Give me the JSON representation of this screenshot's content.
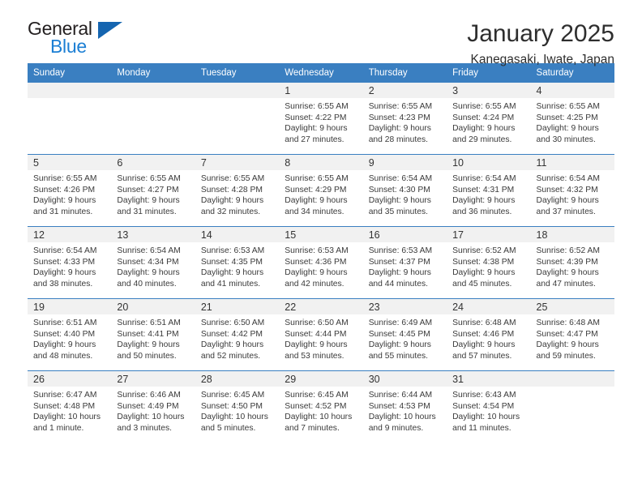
{
  "logo": {
    "text_top": "General",
    "text_bottom": "Blue",
    "triangle_color": "#1565b0",
    "blue_color": "#1c7fd4"
  },
  "header": {
    "month_title": "January 2025",
    "location": "Kanegasaki, Iwate, Japan"
  },
  "theme": {
    "header_blue": "#3a7fc1",
    "daynum_band": "#f1f1f1"
  },
  "weekday_headers": [
    "Sunday",
    "Monday",
    "Tuesday",
    "Wednesday",
    "Thursday",
    "Friday",
    "Saturday"
  ],
  "weeks": [
    [
      {
        "day": "",
        "sunrise": "",
        "sunset": "",
        "daylight_line1": "",
        "daylight_line2": "",
        "empty": true
      },
      {
        "day": "",
        "sunrise": "",
        "sunset": "",
        "daylight_line1": "",
        "daylight_line2": "",
        "empty": true
      },
      {
        "day": "",
        "sunrise": "",
        "sunset": "",
        "daylight_line1": "",
        "daylight_line2": "",
        "empty": true
      },
      {
        "day": "1",
        "sunrise": "Sunrise: 6:55 AM",
        "sunset": "Sunset: 4:22 PM",
        "daylight_line1": "Daylight: 9 hours",
        "daylight_line2": "and 27 minutes."
      },
      {
        "day": "2",
        "sunrise": "Sunrise: 6:55 AM",
        "sunset": "Sunset: 4:23 PM",
        "daylight_line1": "Daylight: 9 hours",
        "daylight_line2": "and 28 minutes."
      },
      {
        "day": "3",
        "sunrise": "Sunrise: 6:55 AM",
        "sunset": "Sunset: 4:24 PM",
        "daylight_line1": "Daylight: 9 hours",
        "daylight_line2": "and 29 minutes."
      },
      {
        "day": "4",
        "sunrise": "Sunrise: 6:55 AM",
        "sunset": "Sunset: 4:25 PM",
        "daylight_line1": "Daylight: 9 hours",
        "daylight_line2": "and 30 minutes."
      }
    ],
    [
      {
        "day": "5",
        "sunrise": "Sunrise: 6:55 AM",
        "sunset": "Sunset: 4:26 PM",
        "daylight_line1": "Daylight: 9 hours",
        "daylight_line2": "and 31 minutes."
      },
      {
        "day": "6",
        "sunrise": "Sunrise: 6:55 AM",
        "sunset": "Sunset: 4:27 PM",
        "daylight_line1": "Daylight: 9 hours",
        "daylight_line2": "and 31 minutes."
      },
      {
        "day": "7",
        "sunrise": "Sunrise: 6:55 AM",
        "sunset": "Sunset: 4:28 PM",
        "daylight_line1": "Daylight: 9 hours",
        "daylight_line2": "and 32 minutes."
      },
      {
        "day": "8",
        "sunrise": "Sunrise: 6:55 AM",
        "sunset": "Sunset: 4:29 PM",
        "daylight_line1": "Daylight: 9 hours",
        "daylight_line2": "and 34 minutes."
      },
      {
        "day": "9",
        "sunrise": "Sunrise: 6:54 AM",
        "sunset": "Sunset: 4:30 PM",
        "daylight_line1": "Daylight: 9 hours",
        "daylight_line2": "and 35 minutes."
      },
      {
        "day": "10",
        "sunrise": "Sunrise: 6:54 AM",
        "sunset": "Sunset: 4:31 PM",
        "daylight_line1": "Daylight: 9 hours",
        "daylight_line2": "and 36 minutes."
      },
      {
        "day": "11",
        "sunrise": "Sunrise: 6:54 AM",
        "sunset": "Sunset: 4:32 PM",
        "daylight_line1": "Daylight: 9 hours",
        "daylight_line2": "and 37 minutes."
      }
    ],
    [
      {
        "day": "12",
        "sunrise": "Sunrise: 6:54 AM",
        "sunset": "Sunset: 4:33 PM",
        "daylight_line1": "Daylight: 9 hours",
        "daylight_line2": "and 38 minutes."
      },
      {
        "day": "13",
        "sunrise": "Sunrise: 6:54 AM",
        "sunset": "Sunset: 4:34 PM",
        "daylight_line1": "Daylight: 9 hours",
        "daylight_line2": "and 40 minutes."
      },
      {
        "day": "14",
        "sunrise": "Sunrise: 6:53 AM",
        "sunset": "Sunset: 4:35 PM",
        "daylight_line1": "Daylight: 9 hours",
        "daylight_line2": "and 41 minutes."
      },
      {
        "day": "15",
        "sunrise": "Sunrise: 6:53 AM",
        "sunset": "Sunset: 4:36 PM",
        "daylight_line1": "Daylight: 9 hours",
        "daylight_line2": "and 42 minutes."
      },
      {
        "day": "16",
        "sunrise": "Sunrise: 6:53 AM",
        "sunset": "Sunset: 4:37 PM",
        "daylight_line1": "Daylight: 9 hours",
        "daylight_line2": "and 44 minutes."
      },
      {
        "day": "17",
        "sunrise": "Sunrise: 6:52 AM",
        "sunset": "Sunset: 4:38 PM",
        "daylight_line1": "Daylight: 9 hours",
        "daylight_line2": "and 45 minutes."
      },
      {
        "day": "18",
        "sunrise": "Sunrise: 6:52 AM",
        "sunset": "Sunset: 4:39 PM",
        "daylight_line1": "Daylight: 9 hours",
        "daylight_line2": "and 47 minutes."
      }
    ],
    [
      {
        "day": "19",
        "sunrise": "Sunrise: 6:51 AM",
        "sunset": "Sunset: 4:40 PM",
        "daylight_line1": "Daylight: 9 hours",
        "daylight_line2": "and 48 minutes."
      },
      {
        "day": "20",
        "sunrise": "Sunrise: 6:51 AM",
        "sunset": "Sunset: 4:41 PM",
        "daylight_line1": "Daylight: 9 hours",
        "daylight_line2": "and 50 minutes."
      },
      {
        "day": "21",
        "sunrise": "Sunrise: 6:50 AM",
        "sunset": "Sunset: 4:42 PM",
        "daylight_line1": "Daylight: 9 hours",
        "daylight_line2": "and 52 minutes."
      },
      {
        "day": "22",
        "sunrise": "Sunrise: 6:50 AM",
        "sunset": "Sunset: 4:44 PM",
        "daylight_line1": "Daylight: 9 hours",
        "daylight_line2": "and 53 minutes."
      },
      {
        "day": "23",
        "sunrise": "Sunrise: 6:49 AM",
        "sunset": "Sunset: 4:45 PM",
        "daylight_line1": "Daylight: 9 hours",
        "daylight_line2": "and 55 minutes."
      },
      {
        "day": "24",
        "sunrise": "Sunrise: 6:48 AM",
        "sunset": "Sunset: 4:46 PM",
        "daylight_line1": "Daylight: 9 hours",
        "daylight_line2": "and 57 minutes."
      },
      {
        "day": "25",
        "sunrise": "Sunrise: 6:48 AM",
        "sunset": "Sunset: 4:47 PM",
        "daylight_line1": "Daylight: 9 hours",
        "daylight_line2": "and 59 minutes."
      }
    ],
    [
      {
        "day": "26",
        "sunrise": "Sunrise: 6:47 AM",
        "sunset": "Sunset: 4:48 PM",
        "daylight_line1": "Daylight: 10 hours",
        "daylight_line2": "and 1 minute."
      },
      {
        "day": "27",
        "sunrise": "Sunrise: 6:46 AM",
        "sunset": "Sunset: 4:49 PM",
        "daylight_line1": "Daylight: 10 hours",
        "daylight_line2": "and 3 minutes."
      },
      {
        "day": "28",
        "sunrise": "Sunrise: 6:45 AM",
        "sunset": "Sunset: 4:50 PM",
        "daylight_line1": "Daylight: 10 hours",
        "daylight_line2": "and 5 minutes."
      },
      {
        "day": "29",
        "sunrise": "Sunrise: 6:45 AM",
        "sunset": "Sunset: 4:52 PM",
        "daylight_line1": "Daylight: 10 hours",
        "daylight_line2": "and 7 minutes."
      },
      {
        "day": "30",
        "sunrise": "Sunrise: 6:44 AM",
        "sunset": "Sunset: 4:53 PM",
        "daylight_line1": "Daylight: 10 hours",
        "daylight_line2": "and 9 minutes."
      },
      {
        "day": "31",
        "sunrise": "Sunrise: 6:43 AM",
        "sunset": "Sunset: 4:54 PM",
        "daylight_line1": "Daylight: 10 hours",
        "daylight_line2": "and 11 minutes."
      },
      {
        "day": "",
        "sunrise": "",
        "sunset": "",
        "daylight_line1": "",
        "daylight_line2": "",
        "empty": true
      }
    ]
  ]
}
